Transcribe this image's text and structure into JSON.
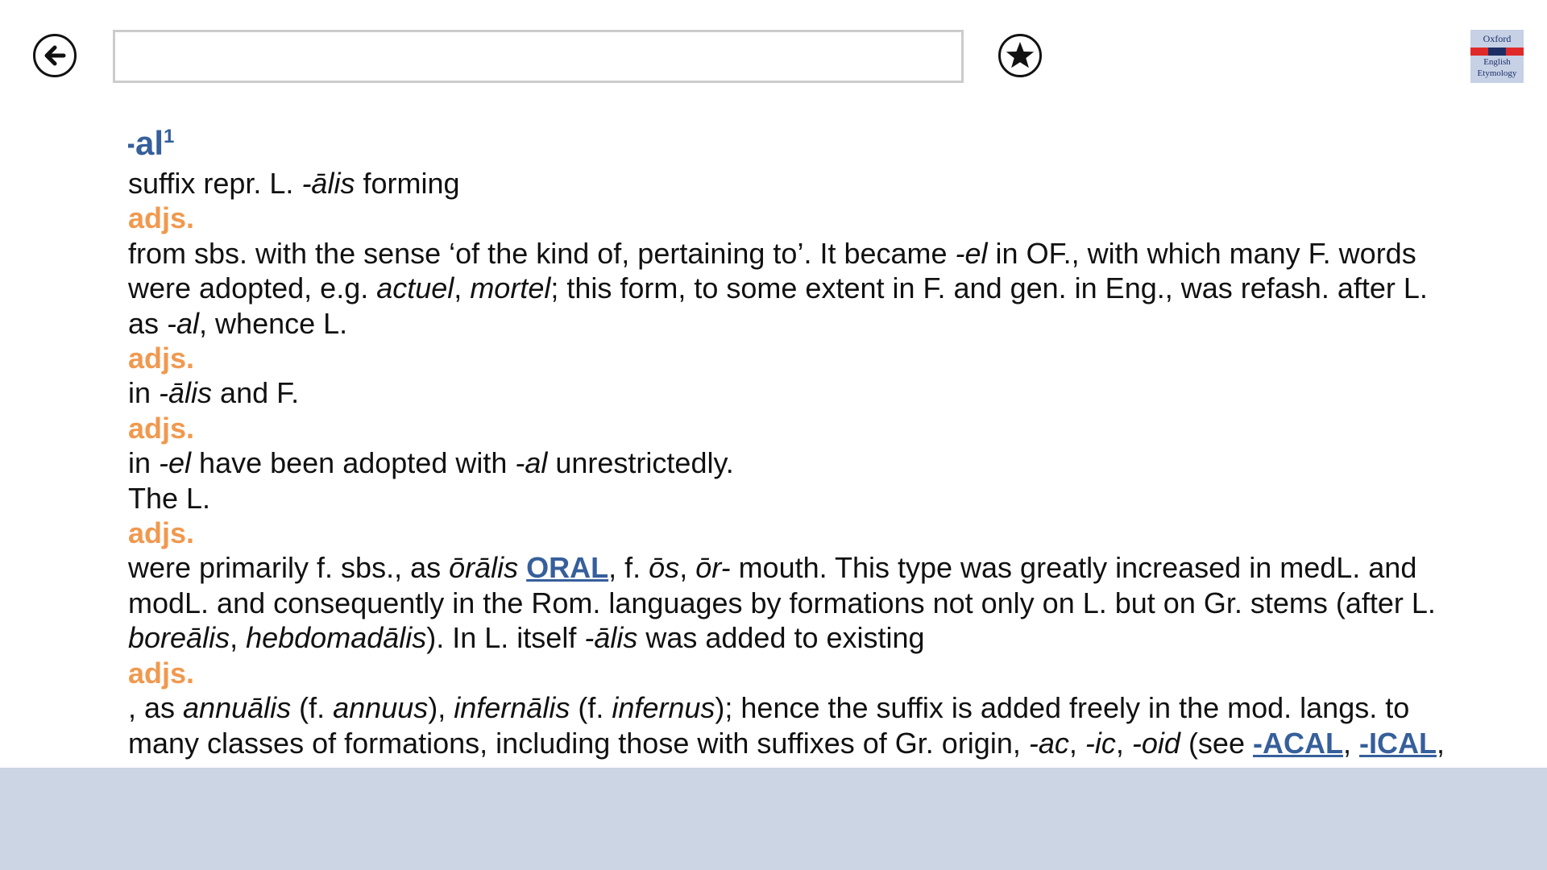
{
  "search": {
    "value": "",
    "placeholder": ""
  },
  "logo": {
    "line1": "Oxford",
    "line2": "English",
    "line3": "Etymology"
  },
  "entry": {
    "headword": "-al",
    "homograph": "1",
    "pos_label": "adjs.",
    "t1a": "suffix repr. L. ",
    "t1b": "-ālis",
    "t1c": " forming",
    "t2a": "from sbs. with the sense ‘of the kind of, pertaining to’. It became ",
    "t2b": "-el",
    "t2c": " in OF., with which many F. words",
    "t3a": "were adopted, e.g. ",
    "t3b": "actuel",
    "t3c": ", ",
    "t3d": "mortel",
    "t3e": "; this form, to some extent in F. and gen. in Eng., was refash. after L.",
    "t4a": "as ",
    "t4b": "-al",
    "t4c": ", whence L.",
    "t5a": "in ",
    "t5b": "-ālis",
    "t5c": " and F.",
    "t6a": "in ",
    "t6b": "-el",
    "t6c": " have been adopted with ",
    "t6d": "-al",
    "t6e": " unrestrictedly.",
    "t7": "The L.",
    "t8a": "were primarily f. sbs., as ",
    "t8b": "ōrālis",
    "t8link": "ORAL",
    "t8c": ", f. ",
    "t8d": "ōs",
    "t8e": ", ",
    "t8f": "ōr-",
    "t8g": " mouth. This type was greatly increased in medL. and",
    "t9": "modL. and consequently in the Rom. languages by formations not only on L. but on Gr. stems (after L.",
    "t10a": "boreālis",
    "t10b": ", ",
    "t10c": "hebdomadālis",
    "t10d": "). In L. itself ",
    "t10e": "-ālis",
    "t10f": " was added to existing",
    "t11a": ", as ",
    "t11b": "annuālis",
    "t11c": " (f. ",
    "t11d": "annuus",
    "t11e": "), ",
    "t11f": "infernālis",
    "t11g": " (f. ",
    "t11h": "infernus",
    "t11i": "); hence the suffix is added freely in the mod. langs. to",
    "t12a": "many classes of formations, including those with suffixes of Gr. origin, ",
    "t12b": "-ac",
    "t12c": ", ",
    "t12d": "-ic",
    "t12e": ", ",
    "t12f": "-oid",
    "t12g": " (see ",
    "t12link1": "-ACAL",
    "t12h": ", ",
    "t12link2": "-ICAL",
    "t12i": ","
  },
  "colors": {
    "headword": "#365f9b",
    "label": "#f0994f",
    "bottom_panel": "#cbd5e3"
  }
}
